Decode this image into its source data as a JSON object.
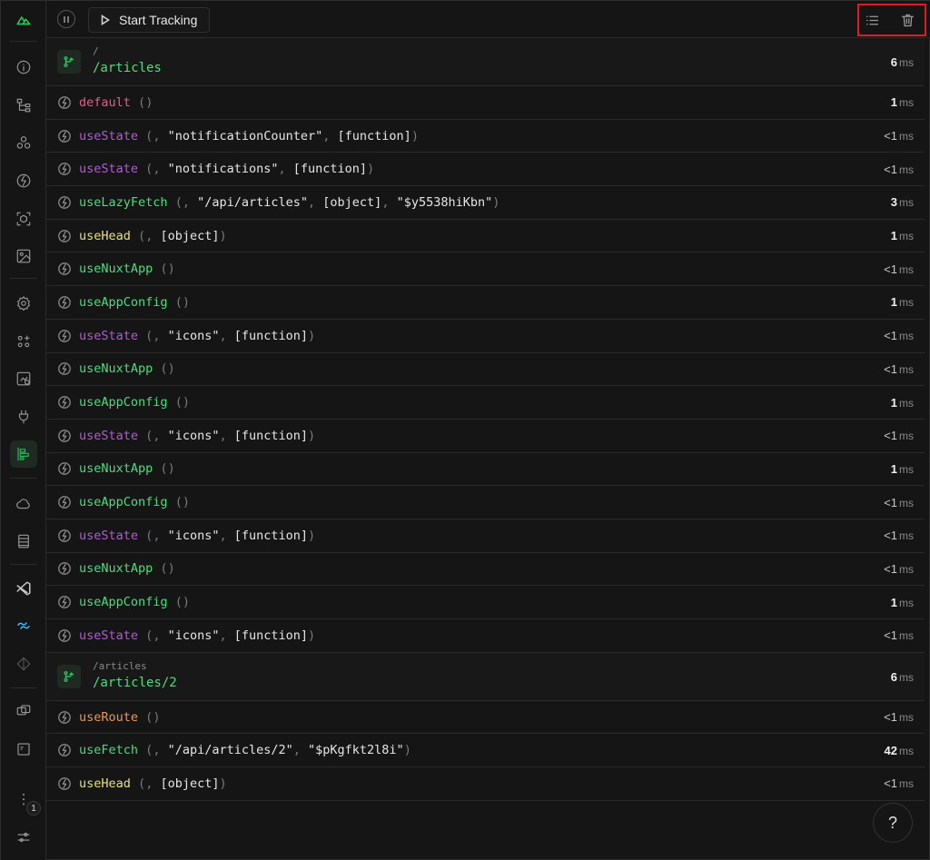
{
  "toolbar": {
    "start_tracking_label": "Start Tracking"
  },
  "sidebar": {
    "items": [
      {
        "icon": "nuxt-logo-icon"
      },
      {
        "icon": "info-icon"
      },
      {
        "icon": "component-tree-icon"
      },
      {
        "icon": "components-icon"
      },
      {
        "icon": "imports-icon"
      },
      {
        "icon": "modules-icon"
      },
      {
        "icon": "assets-icon"
      },
      {
        "icon": "runtime-config-icon"
      },
      {
        "icon": "payload-icon"
      },
      {
        "icon": "render-tree-icon"
      },
      {
        "icon": "plugins-icon"
      },
      {
        "icon": "timeline-icon",
        "active": true
      },
      {
        "icon": "server-icon"
      },
      {
        "icon": "storage-icon"
      },
      {
        "icon": "vscode-icon"
      },
      {
        "icon": "tailwind-icon"
      },
      {
        "icon": "graph-icon"
      },
      {
        "icon": "inspect-icon"
      },
      {
        "icon": "terminal-icon"
      },
      {
        "icon": "more-icon"
      },
      {
        "icon": "settings-icon"
      }
    ],
    "badge": "1"
  },
  "groups": [
    {
      "from": "/",
      "to": "/articles",
      "time": "6",
      "calls": [
        {
          "name": "default",
          "color": "#f0578a",
          "args": [],
          "time": "1",
          "bold": true
        },
        {
          "name": "useState",
          "color": "#b25ad6",
          "args": [
            "\"notificationCounter\"",
            "[function]"
          ],
          "time": "<1",
          "bold": false
        },
        {
          "name": "useState",
          "color": "#b25ad6",
          "args": [
            "\"notifications\"",
            "[function]"
          ],
          "time": "<1",
          "bold": false
        },
        {
          "name": "useLazyFetch",
          "color": "#4ade80",
          "args": [
            "\"/api/articles\"",
            "[object]",
            "\"$y5538hiKbn\""
          ],
          "time": "3",
          "bold": true
        },
        {
          "name": "useHead",
          "color": "#e5e07a",
          "args": [
            "[object]"
          ],
          "time": "1",
          "bold": true
        },
        {
          "name": "useNuxtApp",
          "color": "#4ade80",
          "args": [],
          "time": "<1",
          "bold": false
        },
        {
          "name": "useAppConfig",
          "color": "#4ade80",
          "args": [],
          "time": "1",
          "bold": true
        },
        {
          "name": "useState",
          "color": "#b25ad6",
          "args": [
            "\"icons\"",
            "[function]"
          ],
          "time": "<1",
          "bold": false
        },
        {
          "name": "useNuxtApp",
          "color": "#4ade80",
          "args": [],
          "time": "<1",
          "bold": false
        },
        {
          "name": "useAppConfig",
          "color": "#4ade80",
          "args": [],
          "time": "1",
          "bold": true
        },
        {
          "name": "useState",
          "color": "#b25ad6",
          "args": [
            "\"icons\"",
            "[function]"
          ],
          "time": "<1",
          "bold": false
        },
        {
          "name": "useNuxtApp",
          "color": "#4ade80",
          "args": [],
          "time": "1",
          "bold": true
        },
        {
          "name": "useAppConfig",
          "color": "#4ade80",
          "args": [],
          "time": "<1",
          "bold": false
        },
        {
          "name": "useState",
          "color": "#b25ad6",
          "args": [
            "\"icons\"",
            "[function]"
          ],
          "time": "<1",
          "bold": false
        },
        {
          "name": "useNuxtApp",
          "color": "#4ade80",
          "args": [],
          "time": "<1",
          "bold": false
        },
        {
          "name": "useAppConfig",
          "color": "#4ade80",
          "args": [],
          "time": "1",
          "bold": true
        },
        {
          "name": "useState",
          "color": "#b25ad6",
          "args": [
            "\"icons\"",
            "[function]"
          ],
          "time": "<1",
          "bold": false
        }
      ]
    },
    {
      "from": "/articles",
      "to": "/articles/2",
      "time": "6",
      "calls": [
        {
          "name": "useRoute",
          "color": "#e9985a",
          "args": [],
          "time": "<1",
          "bold": false
        },
        {
          "name": "useFetch",
          "color": "#4ade80",
          "args": [
            "\"/api/articles/2\"",
            "\"$pKgfkt2l8i\""
          ],
          "time": "42",
          "bold": true
        },
        {
          "name": "useHead",
          "color": "#e5e07a",
          "args": [
            "[object]"
          ],
          "time": "<1",
          "bold": false
        }
      ]
    }
  ],
  "units": {
    "ms": "ms"
  },
  "help_label": "?"
}
